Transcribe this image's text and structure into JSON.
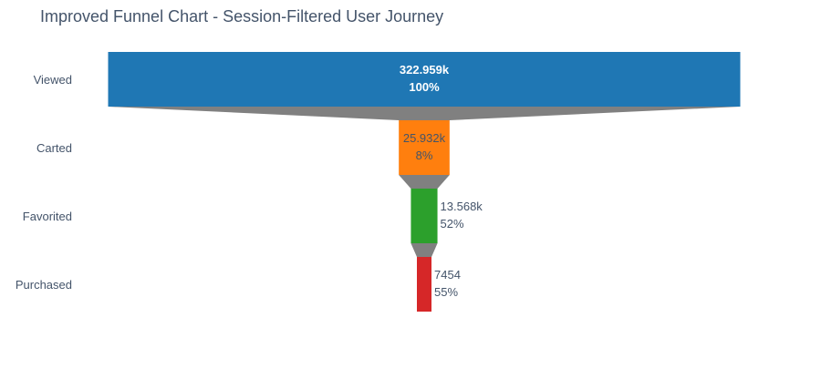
{
  "chart_data": {
    "type": "funnel",
    "title": "Improved Funnel Chart - Session-Filtered User Journey",
    "stages": [
      "Viewed",
      "Carted",
      "Favorited",
      "Purchased"
    ],
    "values": [
      322959,
      25932,
      13568,
      7454
    ],
    "value_labels": [
      "322.959k",
      "25.932k",
      "13.568k",
      "7454"
    ],
    "percent_labels": [
      "100%",
      "8%",
      "52%",
      "55%"
    ],
    "colors": [
      "#1f77b4",
      "#ff7f0e",
      "#2ca02c",
      "#d62728"
    ],
    "connector_color": "#808080",
    "text_color": "#44546a",
    "inside_text_color": "#ffffff"
  }
}
